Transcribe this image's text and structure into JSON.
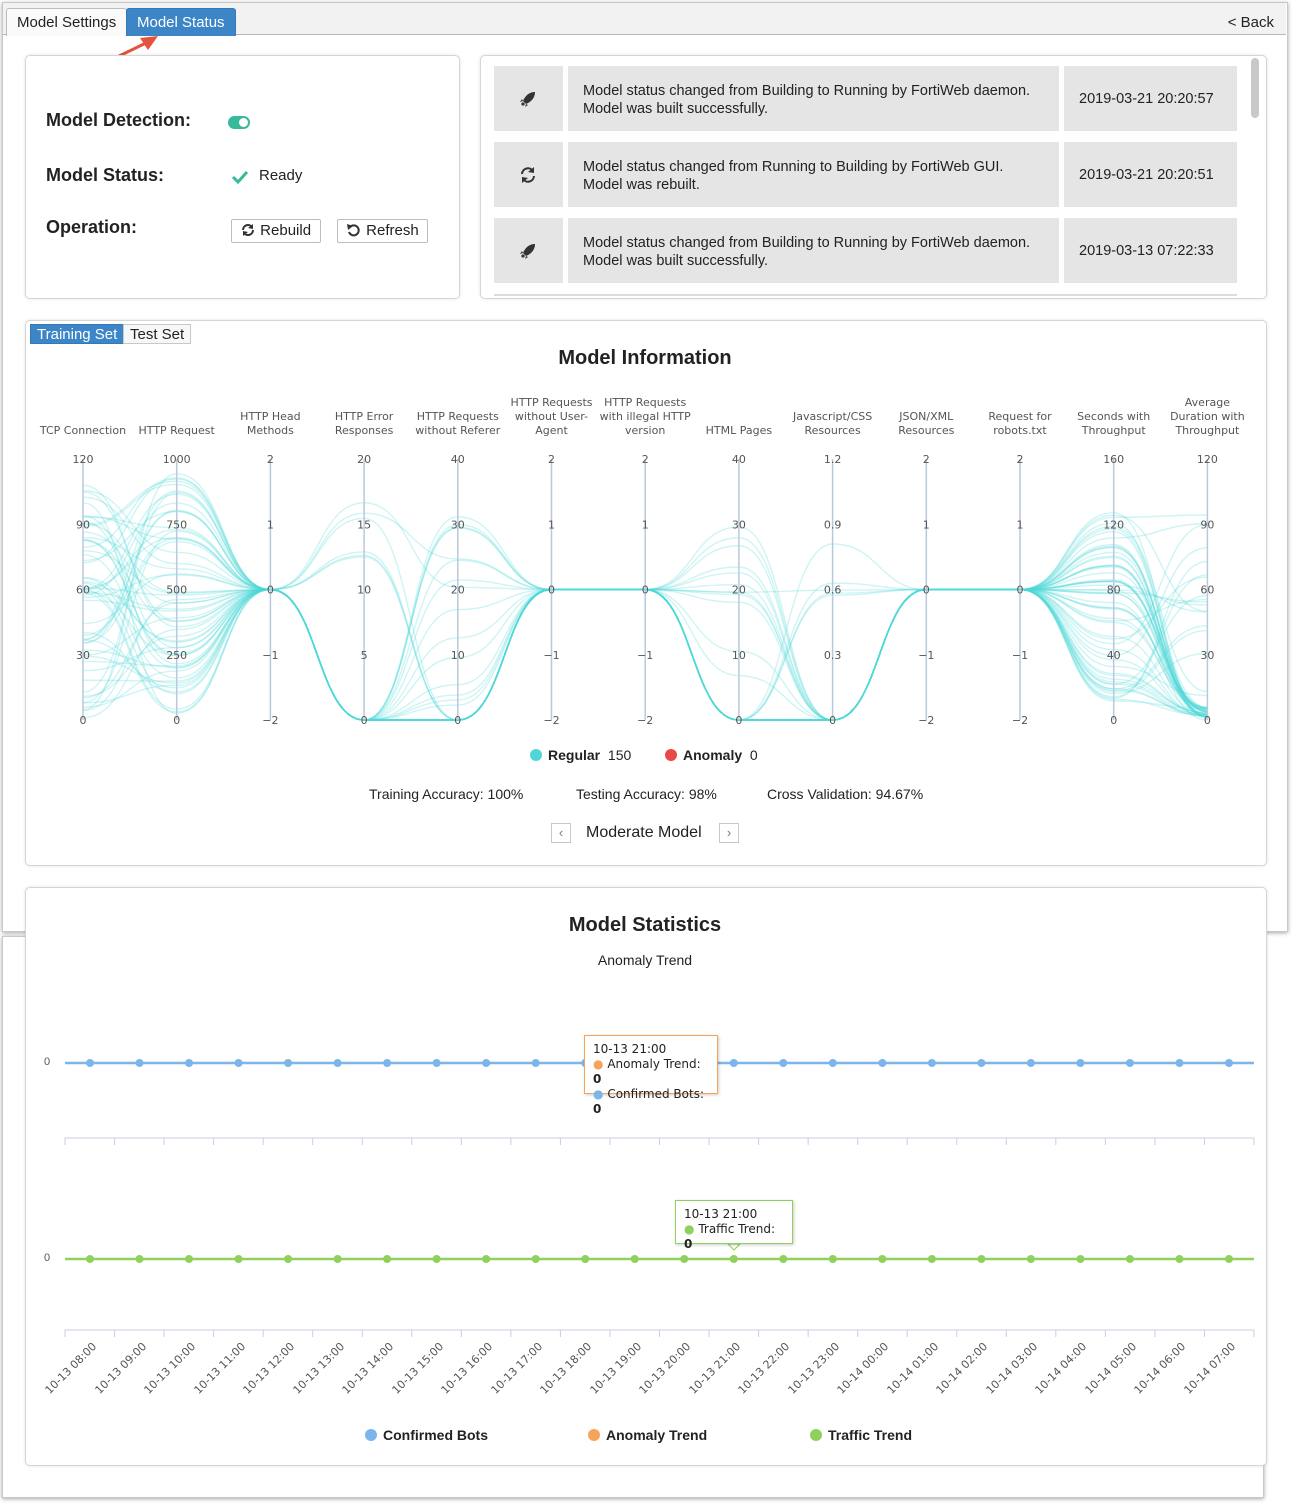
{
  "tabs": {
    "settings": "Model Settings",
    "status": "Model Status",
    "back": "< Back"
  },
  "status_panel": {
    "detection_label": "Model Detection:",
    "status_label": "Model Status:",
    "status_value": "Ready",
    "operation_label": "Operation:",
    "rebuild_label": "Rebuild",
    "refresh_label": "Refresh"
  },
  "events": [
    {
      "icon": "rocket-icon",
      "line1": "Model status changed from Building to Running by FortiWeb daemon.",
      "line2": "Model was built successfully.",
      "time": "2019-03-21 20:20:57"
    },
    {
      "icon": "sync-icon",
      "line1": "Model status changed from Running to Building by FortiWeb GUI.",
      "line2": "Model was rebuilt.",
      "time": "2019-03-21 20:20:51"
    },
    {
      "icon": "rocket-icon",
      "line1": "Model status changed from Building to Running by FortiWeb daemon.",
      "line2": "Model was built successfully.",
      "time": "2019-03-13 07:22:33"
    }
  ],
  "info": {
    "tab_training": "Training Set",
    "tab_test": "Test Set",
    "title": "Model Information",
    "legend_regular": "Regular",
    "legend_regular_count": "150",
    "legend_anomaly": "Anomaly",
    "legend_anomaly_count": "0",
    "training_accuracy": "Training Accuracy: 100%",
    "testing_accuracy": "Testing Accuracy: 98%",
    "cross_validation": "Cross Validation: 94.67%",
    "model_name": "Moderate Model",
    "prev": "‹",
    "next": "›"
  },
  "stats": {
    "title": "Model Statistics",
    "subtitle": "Anomaly Trend",
    "tooltip1_time": "10-13 21:00",
    "tooltip1_a_label": "Anomaly Trend:",
    "tooltip1_a_value": "0",
    "tooltip1_b_label": "Confirmed Bots:",
    "tooltip1_b_value": "0",
    "tooltip2_time": "10-13 21:00",
    "tooltip2_label": "Traffic Trend:",
    "tooltip2_value": "0",
    "legend_confirmed": "Confirmed Bots",
    "legend_anomaly": "Anomaly Trend",
    "legend_traffic": "Traffic Trend"
  },
  "colors": {
    "accent": "#3c86c8",
    "regular": "#4fd6d6",
    "anomaly": "#e84848",
    "confirmed": "#7cb5ec",
    "anomaly_trend": "#f7a35c",
    "traffic": "#90d05c",
    "toggle": "#37b99c"
  },
  "chart_data": [
    {
      "type": "parallel-coordinates",
      "title": "Model Information",
      "axes": [
        {
          "name": "TCP Connection",
          "ticks": [
            "120",
            "90",
            "60",
            "30",
            "0"
          ]
        },
        {
          "name": "HTTP Request",
          "ticks": [
            "1000",
            "750",
            "500",
            "250",
            "0"
          ]
        },
        {
          "name": "HTTP Head Methods",
          "ticks": [
            "2",
            "1",
            "0",
            "−1",
            "−2"
          ]
        },
        {
          "name": "HTTP Error Responses",
          "ticks": [
            "20",
            "15",
            "10",
            "5",
            "0"
          ]
        },
        {
          "name": "HTTP Requests without Referer",
          "ticks": [
            "40",
            "30",
            "20",
            "10",
            "0"
          ]
        },
        {
          "name": "HTTP Requests without User-Agent",
          "ticks": [
            "2",
            "1",
            "0",
            "−1",
            "−2"
          ]
        },
        {
          "name": "HTTP Requests with illegal HTTP version",
          "ticks": [
            "2",
            "1",
            "0",
            "−1",
            "−2"
          ]
        },
        {
          "name": "HTML Pages",
          "ticks": [
            "40",
            "30",
            "20",
            "10",
            "0"
          ]
        },
        {
          "name": "Javascript/CSS Resources",
          "ticks": [
            "1.2",
            "0.9",
            "0.6",
            "0.3",
            "0"
          ]
        },
        {
          "name": "JSON/XML Resources",
          "ticks": [
            "2",
            "1",
            "0",
            "−1",
            "−2"
          ]
        },
        {
          "name": "Request for robots.txt",
          "ticks": [
            "2",
            "1",
            "0",
            "−1",
            "−2"
          ]
        },
        {
          "name": "Seconds with Throughput",
          "ticks": [
            "160",
            "120",
            "80",
            "40",
            "0"
          ]
        },
        {
          "name": "Average Duration with Throughput",
          "ticks": [
            "120",
            "90",
            "60",
            "30",
            "0"
          ]
        }
      ],
      "series": [
        {
          "name": "Regular",
          "count": 150
        },
        {
          "name": "Anomaly",
          "count": 0
        }
      ]
    },
    {
      "type": "line",
      "x": [
        "10-13 08:00",
        "10-13 09:00",
        "10-13 10:00",
        "10-13 11:00",
        "10-13 12:00",
        "10-13 13:00",
        "10-13 14:00",
        "10-13 15:00",
        "10-13 16:00",
        "10-13 17:00",
        "10-13 18:00",
        "10-13 19:00",
        "10-13 20:00",
        "10-13 21:00",
        "10-13 22:00",
        "10-13 23:00",
        "10-14 00:00",
        "10-14 01:00",
        "10-14 02:00",
        "10-14 03:00",
        "10-14 04:00",
        "10-14 05:00",
        "10-14 06:00",
        "10-14 07:00"
      ],
      "series": [
        {
          "name": "Anomaly Trend",
          "values": [
            0,
            0,
            0,
            0,
            0,
            0,
            0,
            0,
            0,
            0,
            0,
            0,
            0,
            0,
            0,
            0,
            0,
            0,
            0,
            0,
            0,
            0,
            0,
            0
          ]
        },
        {
          "name": "Confirmed Bots",
          "values": [
            0,
            0,
            0,
            0,
            0,
            0,
            0,
            0,
            0,
            0,
            0,
            0,
            0,
            0,
            0,
            0,
            0,
            0,
            0,
            0,
            0,
            0,
            0,
            0
          ]
        }
      ],
      "y_ticks": [
        "0"
      ]
    },
    {
      "type": "line",
      "x": [
        "10-13 08:00",
        "10-13 09:00",
        "10-13 10:00",
        "10-13 11:00",
        "10-13 12:00",
        "10-13 13:00",
        "10-13 14:00",
        "10-13 15:00",
        "10-13 16:00",
        "10-13 17:00",
        "10-13 18:00",
        "10-13 19:00",
        "10-13 20:00",
        "10-13 21:00",
        "10-13 22:00",
        "10-13 23:00",
        "10-14 00:00",
        "10-14 01:00",
        "10-14 02:00",
        "10-14 03:00",
        "10-14 04:00",
        "10-14 05:00",
        "10-14 06:00",
        "10-14 07:00"
      ],
      "series": [
        {
          "name": "Traffic Trend",
          "values": [
            0,
            0,
            0,
            0,
            0,
            0,
            0,
            0,
            0,
            0,
            0,
            0,
            0,
            0,
            0,
            0,
            0,
            0,
            0,
            0,
            0,
            0,
            0,
            0
          ]
        }
      ],
      "y_ticks": [
        "0"
      ]
    }
  ]
}
